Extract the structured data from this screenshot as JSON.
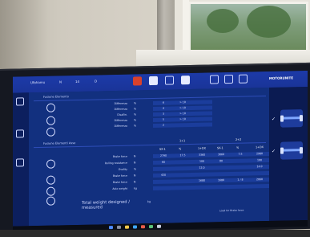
{
  "toolbar": {
    "items": [
      "Ufahamu",
      "N",
      "14",
      "D"
    ],
    "brand": "MOTORUNITE"
  },
  "sections": {
    "first_title": "Fusione Elemento",
    "second_title": "Fusione Elementi Asse"
  },
  "first_table": {
    "column_headers": [
      "",
      "",
      ""
    ],
    "rows": [
      {
        "label": "Differenza",
        "unit": "%",
        "values": [
          "6",
          "> 10",
          ""
        ]
      },
      {
        "label": "Differenza",
        "unit": "%",
        "values": [
          "4",
          "> 10",
          ""
        ]
      },
      {
        "label": "Disallin.",
        "unit": "%",
        "values": [
          "3",
          "> 10",
          ""
        ]
      },
      {
        "label": "Differenza",
        "unit": "%",
        "values": [
          "5",
          "> 10",
          ""
        ]
      },
      {
        "label": "Differenza",
        "unit": "%",
        "values": [
          "2",
          "",
          ""
        ]
      }
    ]
  },
  "second_table": {
    "group_headers": [
      "1+1",
      "2+2"
    ],
    "column_headers": [
      "SX-1",
      "%",
      "1+DX",
      "SX-1",
      "%",
      "1+DX"
    ],
    "rows": [
      {
        "label": "Brake force",
        "unit": "N",
        "values": [
          "2790",
          "17.5",
          "3360",
          "3060",
          "7.5",
          "2980"
        ]
      },
      {
        "label": "Rolling resistance",
        "unit": "N",
        "values": [
          "60",
          "",
          "100",
          "80",
          "",
          "100"
        ]
      },
      {
        "label": "Ovality",
        "unit": "%",
        "values": [
          "",
          "",
          "12.0",
          "",
          "",
          "14.0"
        ]
      },
      {
        "label": "Brake force",
        "unit": "N",
        "values": [
          "420",
          "",
          "",
          "",
          "",
          ""
        ]
      },
      {
        "label": "Brake force",
        "unit": "N",
        "values": [
          "",
          "",
          "1680",
          "1680",
          "1 / 8",
          "2060"
        ]
      },
      {
        "label": "Axle weight",
        "unit": "kg",
        "values": [
          "",
          "",
          "",
          "",
          "",
          ""
        ]
      }
    ]
  },
  "total_weight": {
    "line1": "Total weight designed /",
    "line2": "measured",
    "unit": "kg"
  },
  "footer_note": "Load for Brake force"
}
